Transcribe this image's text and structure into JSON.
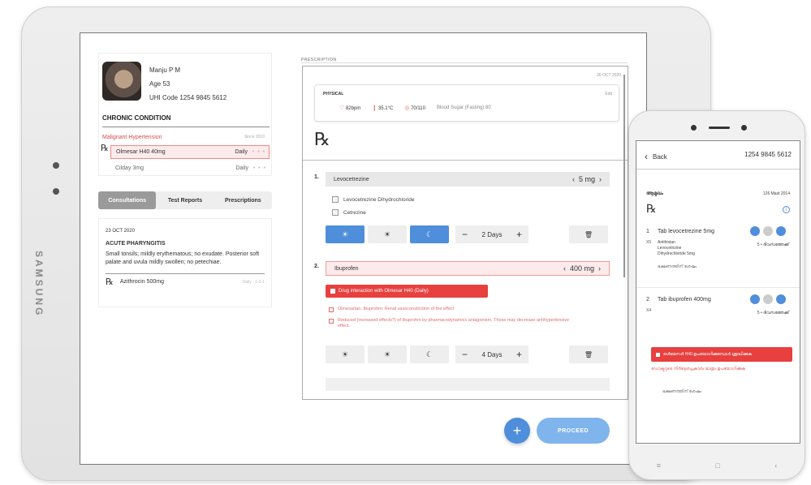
{
  "tablet": {
    "brand": "SAMSUNG",
    "patient": {
      "name": "Manju P M",
      "age": "Age 53",
      "uhid": "UHI Code 1254 9845 5612",
      "chronic_title": "CHRONIC CONDITION",
      "condition": "Malignant Hypertension",
      "condition_since": "Since 2010",
      "rx": "℞",
      "meds": [
        {
          "name": "Olmesar H40 40mg",
          "freq": "Daily",
          "dots": "• • •"
        },
        {
          "name": "Cilday 3mg",
          "freq": "Daily",
          "dots": "• • •"
        }
      ]
    },
    "tabs": [
      "Consultations",
      "Test Reports",
      "Prescriptions"
    ],
    "consult": {
      "date": "23 OCT 2020",
      "diagnosis": "ACUTE PHARYNGITIS",
      "notes": "Small tonsils; mildly erythematous; no exudate. Posterior soft palate and uvula mildly swollen; no petechiae.",
      "rx": "℞",
      "med": "Azithrocin 500mg",
      "med_meta": "Daily · 1-0-1"
    },
    "prescription": {
      "label": "PRESCRIPTION",
      "date": "26 OCT 2020",
      "physical_label": "PHYSICAL",
      "edit": "Edit",
      "vitals": [
        {
          "icon": "♡",
          "value": "82bpm"
        },
        {
          "icon": "❙",
          "value": "35.1°C"
        },
        {
          "icon": "◎",
          "value": "70/110"
        },
        {
          "icon": "",
          "value": "Blood Sugar (Fasting) 80"
        }
      ],
      "rx": "℞",
      "items": [
        {
          "num": "1.",
          "drug": "Levocetrezine",
          "dose": "5 mg",
          "options": [
            "Levocetrezine Dihydrochloride",
            "Cetrezine"
          ],
          "times": [
            "☀",
            "☀",
            "☾"
          ],
          "duration": "2 Days"
        },
        {
          "num": "2.",
          "drug": "Ibuprofen",
          "dose": "400 mg",
          "alert": "Drug interaction with Olmesar H40 (Daily)",
          "warnings": [
            "Olmesartan, Ibuprofen: Renal vasoconstriction of the effect",
            "Reduced (increased effects?) of Ibuprofen by pharmacodynamics antagonism. Those may decrease antihypertensive effect."
          ],
          "times": [
            "☀",
            "☀",
            "☾"
          ],
          "duration": "4 Days"
        }
      ],
      "minus": "−",
      "plus": "+",
      "trash": "🗑",
      "chev_left": "‹",
      "chev_right": "›"
    },
    "fab": "+",
    "proceed": "PROCEED"
  },
  "phone": {
    "back": "Back",
    "back_icon": "‹",
    "id": "1254 9845 5612",
    "patient_short": "ആമുഖം",
    "date": "126 Mast 2014",
    "rx": "℞",
    "info": "i",
    "items": [
      {
        "num": "1",
        "name": "Tab levocetrezine 5mg",
        "tag": "X5",
        "sub": "Antihistan\nLevocetrizine\nDihydrochloride 5mg",
        "dur": "5 • ദിവസത്തേക്ക്",
        "meta": "ഭക്ഷണത്തിന് ശേഷം"
      },
      {
        "num": "2",
        "name": "Tab ibuprofen 400mg",
        "tag": "X4",
        "dur": "5 • ദിവസത്തേക്ക്",
        "meta": "ഭക്ഷണത്തിന് ശേഷം"
      }
    ],
    "alert": "ഒൾമെസർ H40 ഉപയോഗിക്കുമ്പോൾ ശ്രദ്ധിക്കുക",
    "warning": "ഡോക്ടറുടെ നിർദ്ദേശപ്രകാരം മാത്രം ഉപയോഗിക്കുക",
    "nav": [
      "≡",
      "□",
      "‹"
    ]
  }
}
